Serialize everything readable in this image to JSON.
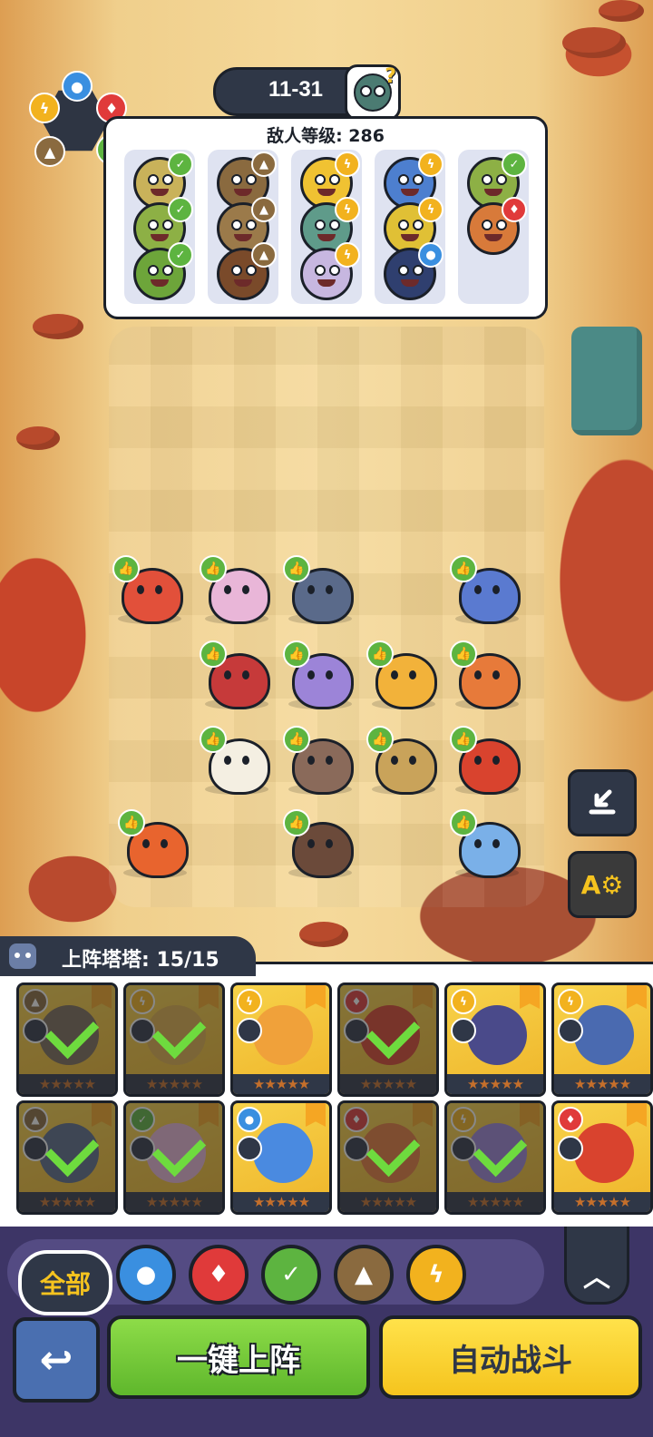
{
  "stage": {
    "label": "11-31",
    "boss_icon": "boss-head-icon"
  },
  "enemy_panel": {
    "level_text": "敌人等级: 286",
    "columns": [
      {
        "enemies": [
          {
            "color": "#c9b25a",
            "element": "leaf"
          },
          {
            "color": "#8db045",
            "element": "leaf"
          },
          {
            "color": "#6da53a",
            "element": "leaf"
          }
        ]
      },
      {
        "enemies": [
          {
            "color": "#8a6a3f",
            "element": "earth"
          },
          {
            "color": "#9b7a4a",
            "element": "earth"
          },
          {
            "color": "#7a4a2a",
            "element": "earth"
          }
        ]
      },
      {
        "enemies": [
          {
            "color": "#f0c232",
            "element": "lightning"
          },
          {
            "color": "#5f9b8a",
            "element": "lightning"
          },
          {
            "color": "#c7b7e0",
            "element": "lightning"
          }
        ]
      },
      {
        "enemies": [
          {
            "color": "#4d7fcf",
            "element": "lightning"
          },
          {
            "color": "#e0c035",
            "element": "lightning"
          },
          {
            "color": "#2f3f6f",
            "element": "water"
          }
        ]
      },
      {
        "enemies": [
          {
            "color": "#8db045",
            "element": "leaf"
          },
          {
            "color": "#d87a3a",
            "element": "fire"
          }
        ]
      }
    ]
  },
  "element_colors": {
    "water": "#3a8fe0",
    "fire": "#e03a3a",
    "leaf": "#5db440",
    "earth": "#8a6a3f",
    "lightning": "#f2b21e"
  },
  "board_units": [
    {
      "color": "#e2503a"
    },
    {
      "color": "#e9b6d8"
    },
    {
      "color": "#5a6a8a"
    },
    {
      "color": "#5a7ad0"
    },
    {
      "color": "#c63a3a"
    },
    {
      "color": "#9c84d8"
    },
    {
      "color": "#f2b23a"
    },
    {
      "color": "#e77a3a"
    },
    {
      "color": "#f4efe2"
    },
    {
      "color": "#8a6a5a"
    },
    {
      "color": "#c9a35a"
    },
    {
      "color": "#d9432e"
    },
    {
      "color": "#e8642e"
    },
    {
      "color": "#6b4a3a"
    },
    {
      "color": "#7ab0e8"
    }
  ],
  "side_buttons": {
    "download": "download-icon",
    "auto_settings": "A⚙"
  },
  "roster": {
    "title": "上阵塔塔: 15/15",
    "cards": [
      {
        "element": "earth",
        "color": "#7a6a5a",
        "deployed": true
      },
      {
        "element": "lightning",
        "color": "#e0b04a",
        "deployed": true
      },
      {
        "element": "lightning",
        "color": "#f0a13a",
        "deployed": false
      },
      {
        "element": "fire",
        "color": "#d9432e",
        "deployed": true
      },
      {
        "element": "lightning",
        "color": "#4a4a8a",
        "deployed": false
      },
      {
        "element": "lightning",
        "color": "#4a6ab0",
        "deployed": false
      },
      {
        "element": "earth",
        "color": "#5a6a8a",
        "deployed": true
      },
      {
        "element": "leaf",
        "color": "#e9b6d8",
        "deployed": true
      },
      {
        "element": "water",
        "color": "#4a8ae0",
        "deployed": false
      },
      {
        "element": "fire",
        "color": "#e77a3a",
        "deployed": true
      },
      {
        "element": "lightning",
        "color": "#9c84d8",
        "deployed": true
      },
      {
        "element": "fire",
        "color": "#d9432e",
        "deployed": false
      }
    ]
  },
  "filters": {
    "all_label": "全部",
    "buttons": [
      "water",
      "fire",
      "leaf",
      "earth",
      "lightning"
    ]
  },
  "actions": {
    "back_icon": "back-arrow-icon",
    "deploy_label": "一键上阵",
    "auto_battle_label": "自动战斗"
  }
}
